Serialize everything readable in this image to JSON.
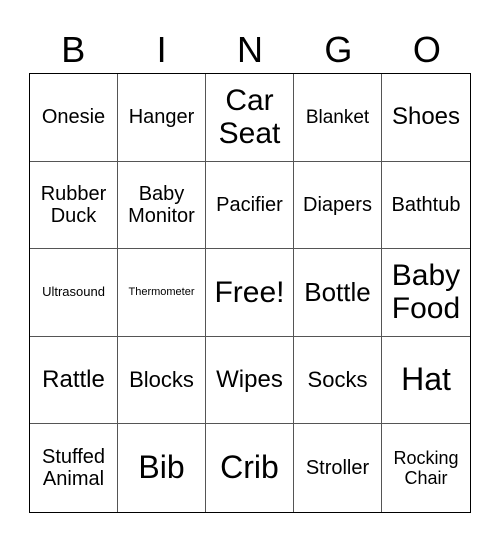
{
  "header": [
    "B",
    "I",
    "N",
    "G",
    "O"
  ],
  "cells": [
    {
      "text": "Onesie",
      "size": 20
    },
    {
      "text": "Hanger",
      "size": 20
    },
    {
      "text": "Car Seat",
      "size": 30
    },
    {
      "text": "Blanket",
      "size": 19
    },
    {
      "text": "Shoes",
      "size": 24
    },
    {
      "text": "Rubber Duck",
      "size": 20
    },
    {
      "text": "Baby Monitor",
      "size": 20
    },
    {
      "text": "Pacifier",
      "size": 20
    },
    {
      "text": "Diapers",
      "size": 20
    },
    {
      "text": "Bathtub",
      "size": 20
    },
    {
      "text": "Ultrasound",
      "size": 13
    },
    {
      "text": "Thermometer",
      "size": 11
    },
    {
      "text": "Free!",
      "size": 30
    },
    {
      "text": "Bottle",
      "size": 26
    },
    {
      "text": "Baby Food",
      "size": 30
    },
    {
      "text": "Rattle",
      "size": 24
    },
    {
      "text": "Blocks",
      "size": 22
    },
    {
      "text": "Wipes",
      "size": 24
    },
    {
      "text": "Socks",
      "size": 22
    },
    {
      "text": "Hat",
      "size": 32
    },
    {
      "text": "Stuffed Animal",
      "size": 20
    },
    {
      "text": "Bib",
      "size": 32
    },
    {
      "text": "Crib",
      "size": 32
    },
    {
      "text": "Stroller",
      "size": 20
    },
    {
      "text": "Rocking Chair",
      "size": 18
    }
  ]
}
